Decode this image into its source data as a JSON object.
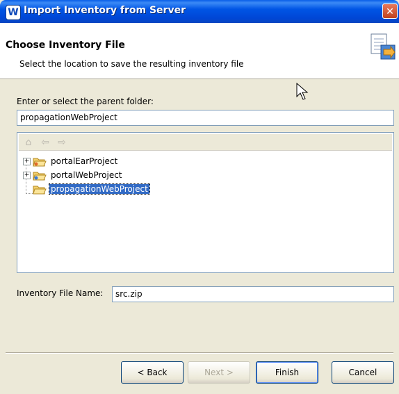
{
  "window": {
    "title": "Import Inventory from Server",
    "app_icon_glyph": "W",
    "close_glyph": "✕",
    "titlebar_color": "#0055E5"
  },
  "header": {
    "title": "Choose Inventory File",
    "description": "Select the location to save the resulting inventory file",
    "icon": "wizard-import-icon"
  },
  "parent_folder": {
    "label": "Enter or select the parent folder:",
    "value": "propagationWebProject"
  },
  "tree": {
    "toolbar": [
      "home-icon",
      "back-arrow-icon",
      "forward-arrow-icon"
    ],
    "items": [
      {
        "label": "portalEarProject",
        "expandable": true,
        "selected": false
      },
      {
        "label": "portalWebProject",
        "expandable": true,
        "selected": false
      },
      {
        "label": "propagationWebProject",
        "expandable": false,
        "selected": true
      }
    ],
    "selection_color": "#316AC5"
  },
  "inventory_file": {
    "label": "Inventory File Name:",
    "value": "src.zip"
  },
  "buttons": {
    "back": "< Back",
    "next": "Next >",
    "finish": "Finish",
    "cancel": "Cancel"
  }
}
